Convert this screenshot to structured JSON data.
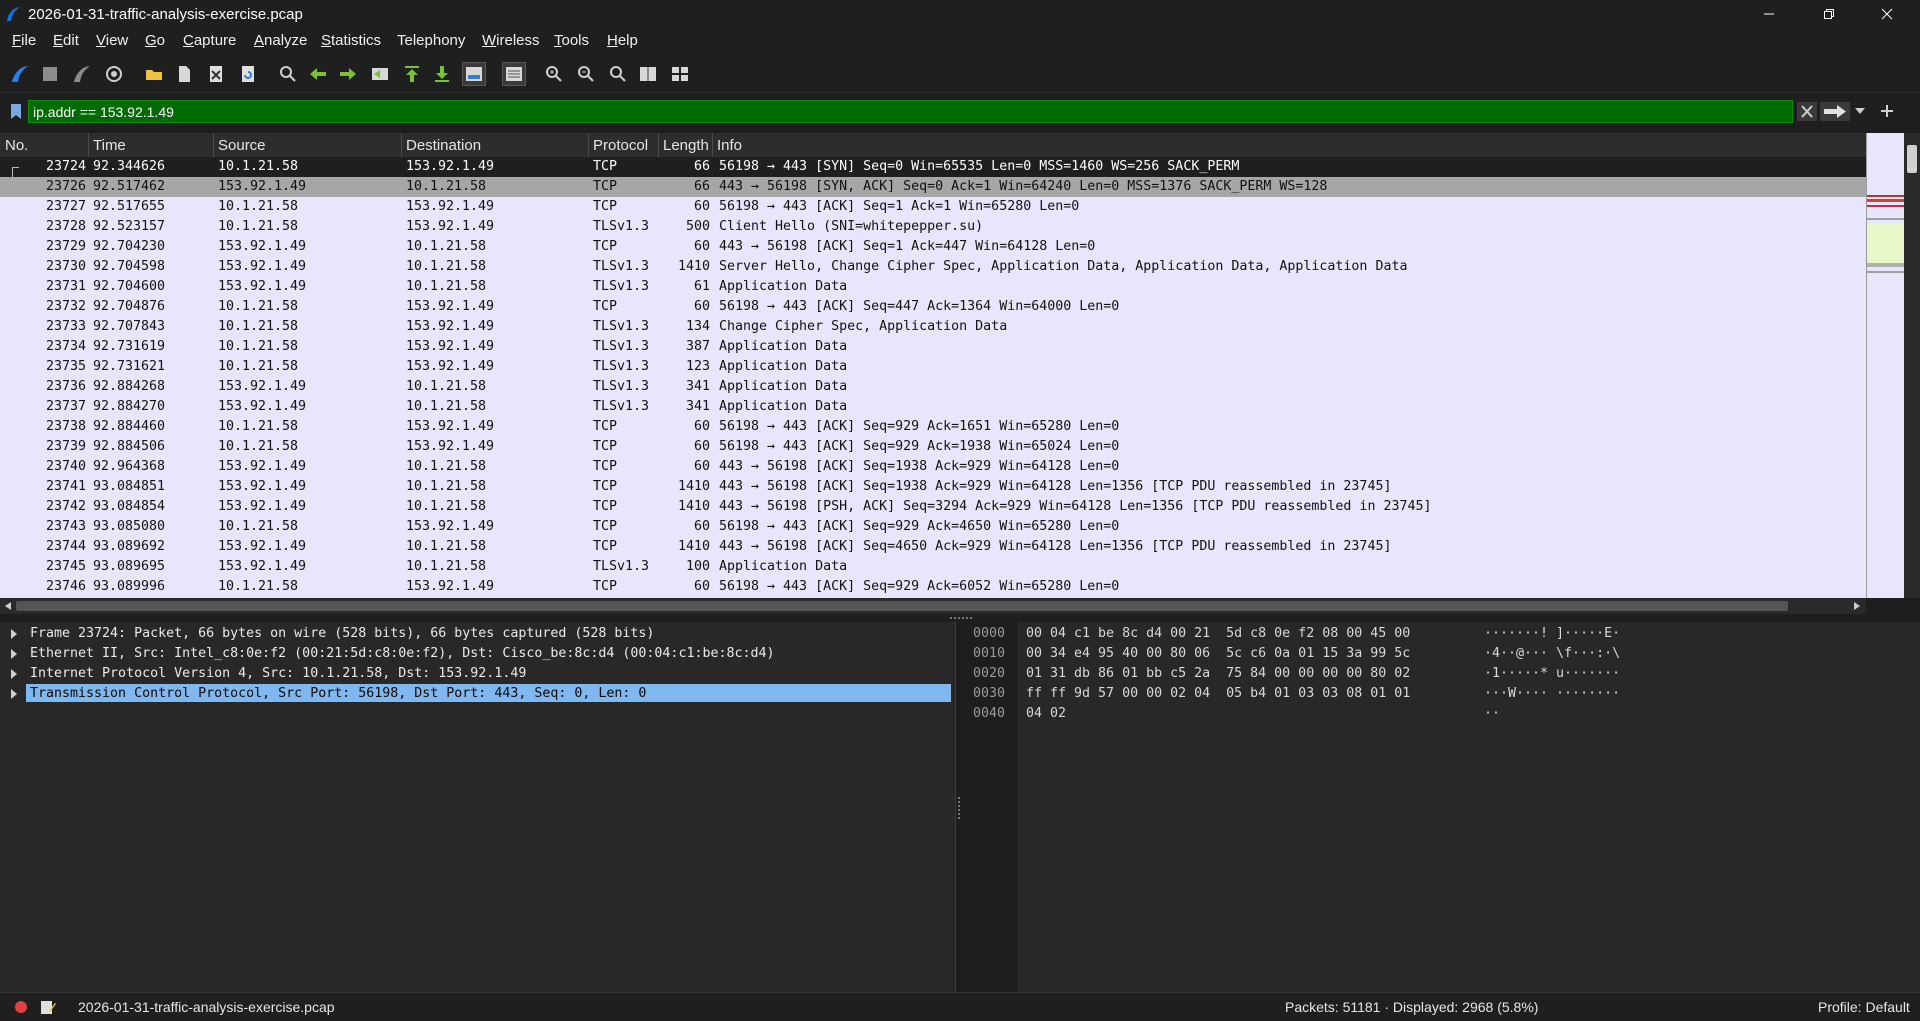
{
  "window": {
    "title": "2026-01-31-traffic-analysis-exercise.pcap"
  },
  "menu": [
    {
      "label": "File",
      "ul": "F",
      "rest": "ile"
    },
    {
      "label": "Edit",
      "ul": "E",
      "rest": "dit"
    },
    {
      "label": "View",
      "ul": "V",
      "rest": "iew"
    },
    {
      "label": "Go",
      "ul": "G",
      "rest": "o"
    },
    {
      "label": "Capture",
      "ul": "C",
      "rest": "apture"
    },
    {
      "label": "Analyze",
      "ul": "A",
      "rest": "nalyze"
    },
    {
      "label": "Statistics",
      "ul": "S",
      "rest": "tatistics"
    },
    {
      "label": "Telephony",
      "ul": "",
      "rest": "Telephony"
    },
    {
      "label": "Wireless",
      "ul": "W",
      "rest": "ireless"
    },
    {
      "label": "Tools",
      "ul": "T",
      "rest": "ools"
    },
    {
      "label": "Help",
      "ul": "H",
      "rest": "elp"
    }
  ],
  "filter": {
    "value": "ip.addr == 153.92.1.49"
  },
  "columns": {
    "no": "No.",
    "time": "Time",
    "source": "Source",
    "destination": "Destination",
    "protocol": "Protocol",
    "length": "Length",
    "info": "Info"
  },
  "packets": [
    {
      "no": "23724",
      "time": "92.344626",
      "src": "10.1.21.58",
      "dst": "153.92.1.49",
      "proto": "TCP",
      "len": "66",
      "info": "56198 → 443 [SYN] Seq=0 Win=65535 Len=0 MSS=1460 WS=256 SACK_PERM"
    },
    {
      "no": "23726",
      "time": "92.517462",
      "src": "153.92.1.49",
      "dst": "10.1.21.58",
      "proto": "TCP",
      "len": "66",
      "info": "443 → 56198 [SYN, ACK] Seq=0 Ack=1 Win=64240 Len=0 MSS=1376 SACK_PERM WS=128"
    },
    {
      "no": "23727",
      "time": "92.517655",
      "src": "10.1.21.58",
      "dst": "153.92.1.49",
      "proto": "TCP",
      "len": "60",
      "info": "56198 → 443 [ACK] Seq=1 Ack=1 Win=65280 Len=0"
    },
    {
      "no": "23728",
      "time": "92.523157",
      "src": "10.1.21.58",
      "dst": "153.92.1.49",
      "proto": "TLSv1.3",
      "len": "500",
      "info": "Client Hello (SNI=whitepepper.su)"
    },
    {
      "no": "23729",
      "time": "92.704230",
      "src": "153.92.1.49",
      "dst": "10.1.21.58",
      "proto": "TCP",
      "len": "60",
      "info": "443 → 56198 [ACK] Seq=1 Ack=447 Win=64128 Len=0"
    },
    {
      "no": "23730",
      "time": "92.704598",
      "src": "153.92.1.49",
      "dst": "10.1.21.58",
      "proto": "TLSv1.3",
      "len": "1410",
      "info": "Server Hello, Change Cipher Spec, Application Data, Application Data, Application Data"
    },
    {
      "no": "23731",
      "time": "92.704600",
      "src": "153.92.1.49",
      "dst": "10.1.21.58",
      "proto": "TLSv1.3",
      "len": "61",
      "info": "Application Data"
    },
    {
      "no": "23732",
      "time": "92.704876",
      "src": "10.1.21.58",
      "dst": "153.92.1.49",
      "proto": "TCP",
      "len": "60",
      "info": "56198 → 443 [ACK] Seq=447 Ack=1364 Win=64000 Len=0"
    },
    {
      "no": "23733",
      "time": "92.707843",
      "src": "10.1.21.58",
      "dst": "153.92.1.49",
      "proto": "TLSv1.3",
      "len": "134",
      "info": "Change Cipher Spec, Application Data"
    },
    {
      "no": "23734",
      "time": "92.731619",
      "src": "10.1.21.58",
      "dst": "153.92.1.49",
      "proto": "TLSv1.3",
      "len": "387",
      "info": "Application Data"
    },
    {
      "no": "23735",
      "time": "92.731621",
      "src": "10.1.21.58",
      "dst": "153.92.1.49",
      "proto": "TLSv1.3",
      "len": "123",
      "info": "Application Data"
    },
    {
      "no": "23736",
      "time": "92.884268",
      "src": "153.92.1.49",
      "dst": "10.1.21.58",
      "proto": "TLSv1.3",
      "len": "341",
      "info": "Application Data"
    },
    {
      "no": "23737",
      "time": "92.884270",
      "src": "153.92.1.49",
      "dst": "10.1.21.58",
      "proto": "TLSv1.3",
      "len": "341",
      "info": "Application Data"
    },
    {
      "no": "23738",
      "time": "92.884460",
      "src": "10.1.21.58",
      "dst": "153.92.1.49",
      "proto": "TCP",
      "len": "60",
      "info": "56198 → 443 [ACK] Seq=929 Ack=1651 Win=65280 Len=0"
    },
    {
      "no": "23739",
      "time": "92.884506",
      "src": "10.1.21.58",
      "dst": "153.92.1.49",
      "proto": "TCP",
      "len": "60",
      "info": "56198 → 443 [ACK] Seq=929 Ack=1938 Win=65024 Len=0"
    },
    {
      "no": "23740",
      "time": "92.964368",
      "src": "153.92.1.49",
      "dst": "10.1.21.58",
      "proto": "TCP",
      "len": "60",
      "info": "443 → 56198 [ACK] Seq=1938 Ack=929 Win=64128 Len=0"
    },
    {
      "no": "23741",
      "time": "93.084851",
      "src": "153.92.1.49",
      "dst": "10.1.21.58",
      "proto": "TCP",
      "len": "1410",
      "info": "443 → 56198 [ACK] Seq=1938 Ack=929 Win=64128 Len=1356 [TCP PDU reassembled in 23745]"
    },
    {
      "no": "23742",
      "time": "93.084854",
      "src": "153.92.1.49",
      "dst": "10.1.21.58",
      "proto": "TCP",
      "len": "1410",
      "info": "443 → 56198 [PSH, ACK] Seq=3294 Ack=929 Win=64128 Len=1356 [TCP PDU reassembled in 23745]"
    },
    {
      "no": "23743",
      "time": "93.085080",
      "src": "10.1.21.58",
      "dst": "153.92.1.49",
      "proto": "TCP",
      "len": "60",
      "info": "56198 → 443 [ACK] Seq=929 Ack=4650 Win=65280 Len=0"
    },
    {
      "no": "23744",
      "time": "93.089692",
      "src": "153.92.1.49",
      "dst": "10.1.21.58",
      "proto": "TCP",
      "len": "1410",
      "info": "443 → 56198 [ACK] Seq=4650 Ack=929 Win=64128 Len=1356 [TCP PDU reassembled in 23745]"
    },
    {
      "no": "23745",
      "time": "93.089695",
      "src": "153.92.1.49",
      "dst": "10.1.21.58",
      "proto": "TLSv1.3",
      "len": "100",
      "info": "Application Data"
    },
    {
      "no": "23746",
      "time": "93.089996",
      "src": "10.1.21.58",
      "dst": "153.92.1.49",
      "proto": "TCP",
      "len": "60",
      "info": "56198 → 443 [ACK] Seq=929 Ack=6052 Win=65280 Len=0"
    }
  ],
  "details": [
    "Frame 23724: Packet, 66 bytes on wire (528 bits), 66 bytes captured (528 bits)",
    "Ethernet II, Src: Intel_c8:0e:f2 (00:21:5d:c8:0e:f2), Dst: Cisco_be:8c:d4 (00:04:c1:be:8c:d4)",
    "Internet Protocol Version 4, Src: 10.1.21.58, Dst: 153.92.1.49",
    "Transmission Control Protocol, Src Port: 56198, Dst Port: 443, Seq: 0, Len: 0"
  ],
  "bytes": [
    {
      "offset": "0000",
      "hex": "00 04 c1 be 8c d4 00 21  5d c8 0e f2 08 00 45 00",
      "ascii": "·······! ]·····E·"
    },
    {
      "offset": "0010",
      "hex": "00 34 e4 95 40 00 80 06  5c c6 0a 01 15 3a 99 5c",
      "ascii": "·4··@··· \\f···:·\\"
    },
    {
      "offset": "0020",
      "hex": "01 31 db 86 01 bb c5 2a  75 84 00 00 00 00 80 02",
      "ascii": "·1·····* u·······"
    },
    {
      "offset": "0030",
      "hex": "ff ff 9d 57 00 00 02 04  05 b4 01 03 03 08 01 01",
      "ascii": "···W···· ········"
    },
    {
      "offset": "0040",
      "hex": "04 02",
      "ascii": "··"
    }
  ],
  "status": {
    "file": "2026-01-31-traffic-analysis-exercise.pcap",
    "packets": "Packets: 51181 · Displayed: 2968 (5.8%)",
    "profile": "Profile: Default"
  }
}
